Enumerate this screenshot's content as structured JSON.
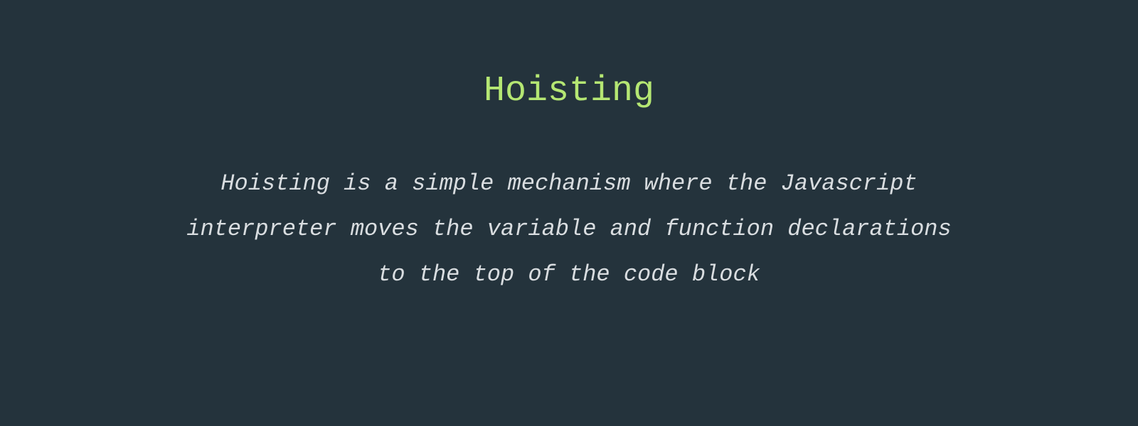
{
  "slide": {
    "title": "Hoisting",
    "description": "Hoisting is a simple mechanism where the Javascript interpreter moves the variable and function declarations to the top of the code block"
  },
  "colors": {
    "background": "#24333c",
    "title": "#b5e773",
    "text": "#d9dde0"
  }
}
